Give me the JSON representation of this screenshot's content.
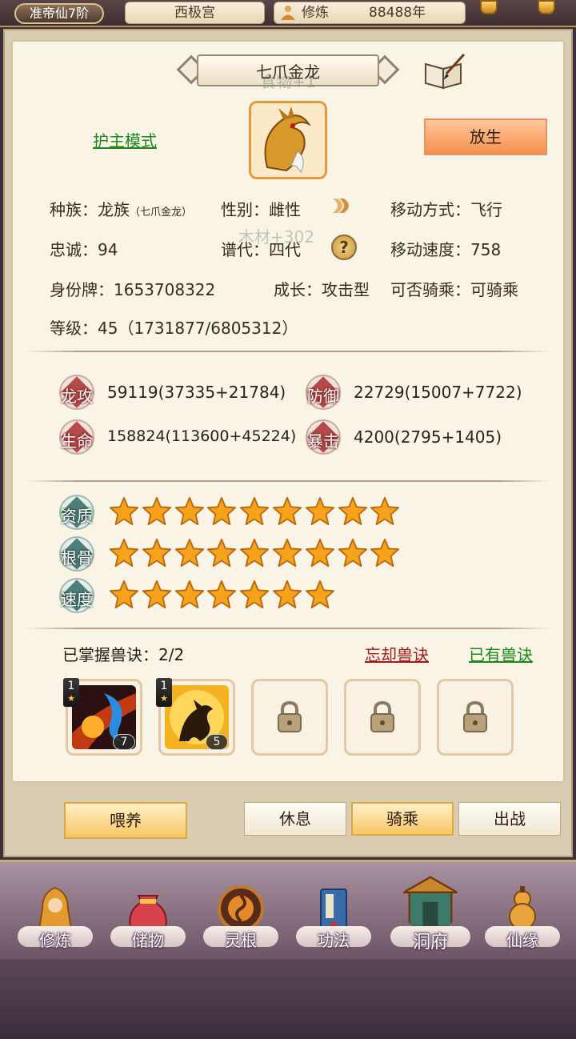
{
  "topbar": {
    "rank": "准帝仙7阶",
    "location": "西极宫",
    "cultivate_label": "修炼",
    "cultivate_years": "88488年"
  },
  "pet": {
    "name": "七爪金龙",
    "floating_title": "食物+1",
    "guard_mode": "护主模式",
    "release_button": "放生",
    "race": "种族：龙族",
    "race_detail": "（七爪金龙）",
    "gender": "性别：雌性",
    "move_type": "移动方式：飞行",
    "loyalty": "忠诚：94",
    "generation": "谱代：四代",
    "move_speed": "移动速度：758",
    "id_tag": "身份牌：1653708322",
    "growth": "成长：攻击型",
    "rideable": "可否骑乘：可骑乘",
    "level": "等级：45（1731877/6805312）",
    "floating_reward": "木材+302",
    "help_glyph": "?"
  },
  "stats": [
    {
      "label": "龙攻",
      "value": "59119(37335+21784)"
    },
    {
      "label": "防御",
      "value": "22729(15007+7722)"
    },
    {
      "label": "生命",
      "value": "158824(113600+45224)"
    },
    {
      "label": "暴击",
      "value": "4200(2795+1405)"
    }
  ],
  "aptitudes": [
    {
      "label": "资质",
      "stars": 9
    },
    {
      "label": "根骨",
      "stars": 9
    },
    {
      "label": "速度",
      "stars": 7
    }
  ],
  "skills": {
    "mastered": "已掌握兽诀：2/2",
    "forget_link": "忘却兽诀",
    "owned_link": "已有兽诀",
    "slots": [
      {
        "level": "1",
        "count": "7",
        "art": "blue-dragon-fire",
        "locked": false
      },
      {
        "level": "1",
        "count": "5",
        "art": "golden-dragon",
        "locked": false
      },
      {
        "locked": true
      },
      {
        "locked": true
      },
      {
        "locked": true
      }
    ]
  },
  "actions": {
    "feed": "喂养",
    "rest": "休息",
    "ride": "骑乘",
    "battle": "出战",
    "active": "ride"
  },
  "nav": [
    {
      "label": "修炼",
      "icon": "monk-icon"
    },
    {
      "label": "储物",
      "icon": "treasure-bag-icon"
    },
    {
      "label": "灵根",
      "icon": "spirit-root-icon"
    },
    {
      "label": "功法",
      "icon": "scroll-book-icon"
    },
    {
      "label": "洞府",
      "icon": "cave-mansion-icon"
    },
    {
      "label": "仙缘",
      "icon": "gourd-icon"
    }
  ],
  "colors": {
    "accent_orange": "#f6904f",
    "link_green": "#1b8a1b",
    "link_red": "#a8191c",
    "star": "#f7a21b"
  }
}
